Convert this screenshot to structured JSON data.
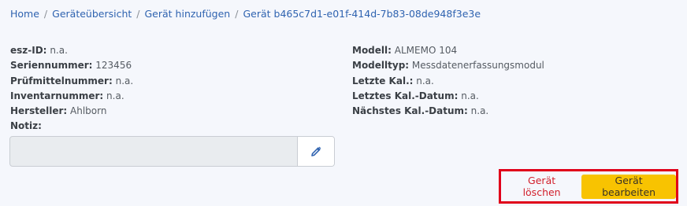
{
  "breadcrumb": {
    "items": [
      {
        "label": "Home"
      },
      {
        "label": "Geräteübersicht"
      },
      {
        "label": "Gerät hinzufügen"
      },
      {
        "label": "Gerät b465c7d1-e01f-414d-7b83-08de948f3e3e"
      }
    ],
    "separator": "/"
  },
  "details_left": [
    {
      "label": "esz-ID:",
      "value": "n.a."
    },
    {
      "label": "Seriennummer:",
      "value": "123456"
    },
    {
      "label": "Prüfmittelnummer:",
      "value": "n.a."
    },
    {
      "label": "Inventarnummer:",
      "value": "n.a."
    },
    {
      "label": "Hersteller:",
      "value": "Ahlborn"
    },
    {
      "label": "Notiz:",
      "value": ""
    }
  ],
  "details_right": [
    {
      "label": "Modell:",
      "value": "ALMEMO 104"
    },
    {
      "label": "Modelltyp:",
      "value": "Messdatenerfassungsmodul"
    },
    {
      "label": "Letzte Kal.:",
      "value": "n.a."
    },
    {
      "label": "Letztes Kal.-Datum:",
      "value": "n.a."
    },
    {
      "label": "Nächstes Kal.-Datum:",
      "value": "n.a."
    }
  ],
  "note": {
    "value": "",
    "edit_icon": "pencil-icon"
  },
  "actions": {
    "delete_label": "Gerät löschen",
    "edit_label": "Gerät bearbeiten"
  },
  "colors": {
    "link": "#2f63b0",
    "delete": "#d21f2b",
    "primary": "#f8c301",
    "highlight_frame": "#e0001a",
    "background": "#f5f7fc"
  }
}
